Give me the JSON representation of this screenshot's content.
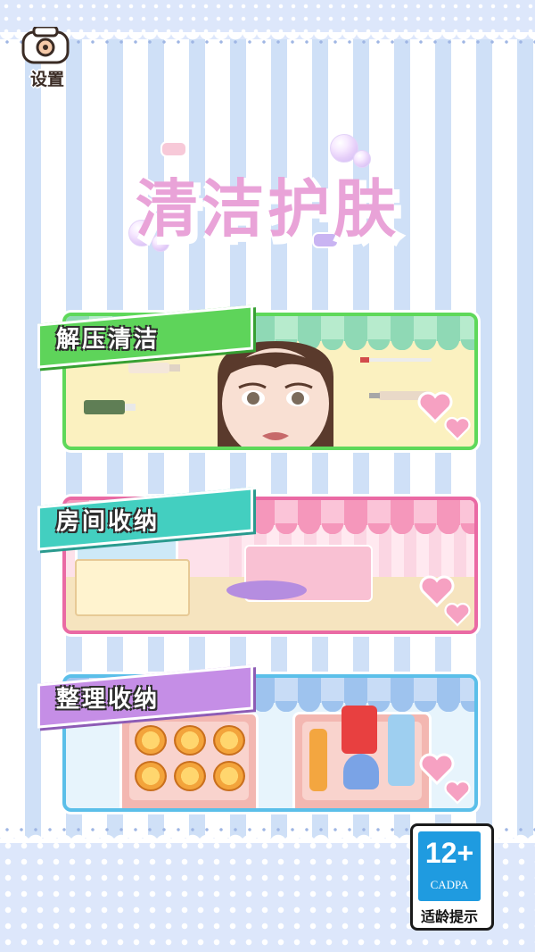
{
  "settings": {
    "label": "设置"
  },
  "title": "清洁护肤",
  "cards": [
    {
      "label": "解压清洁"
    },
    {
      "label": "房间收纳"
    },
    {
      "label": "整理收纳"
    }
  ],
  "age_badge": {
    "rating": "12+",
    "org": "CADPA",
    "tip": "适龄提示"
  },
  "colors": {
    "card1_border": "#5ed85a",
    "card2_border": "#ea6aa4",
    "card3_border": "#5bbfe9",
    "title": "#e9a3d8",
    "background_stripe": "#cfe0f7"
  }
}
